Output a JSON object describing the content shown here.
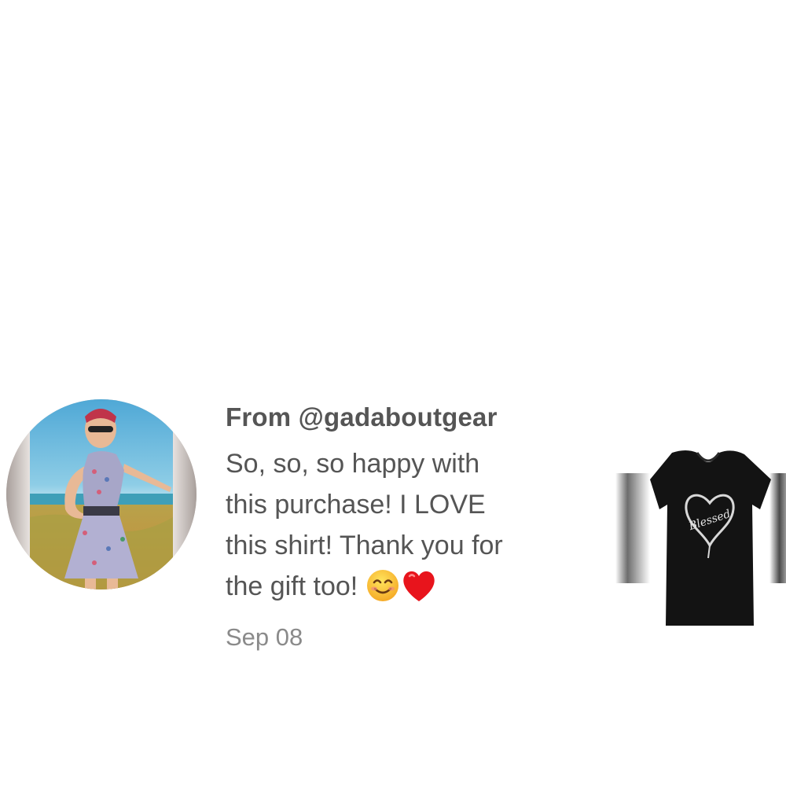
{
  "review": {
    "from_label": "From @gadaboutgear",
    "lines": [
      "So, so, so happy with",
      "this purchase! I LOVE",
      "this shirt! Thank you for",
      "the gift too!"
    ],
    "emojis": [
      "smiling-face-emoji",
      "red-heart-emoji"
    ],
    "date": "Sep 08"
  },
  "product": {
    "shirt_script": "Blessed"
  }
}
